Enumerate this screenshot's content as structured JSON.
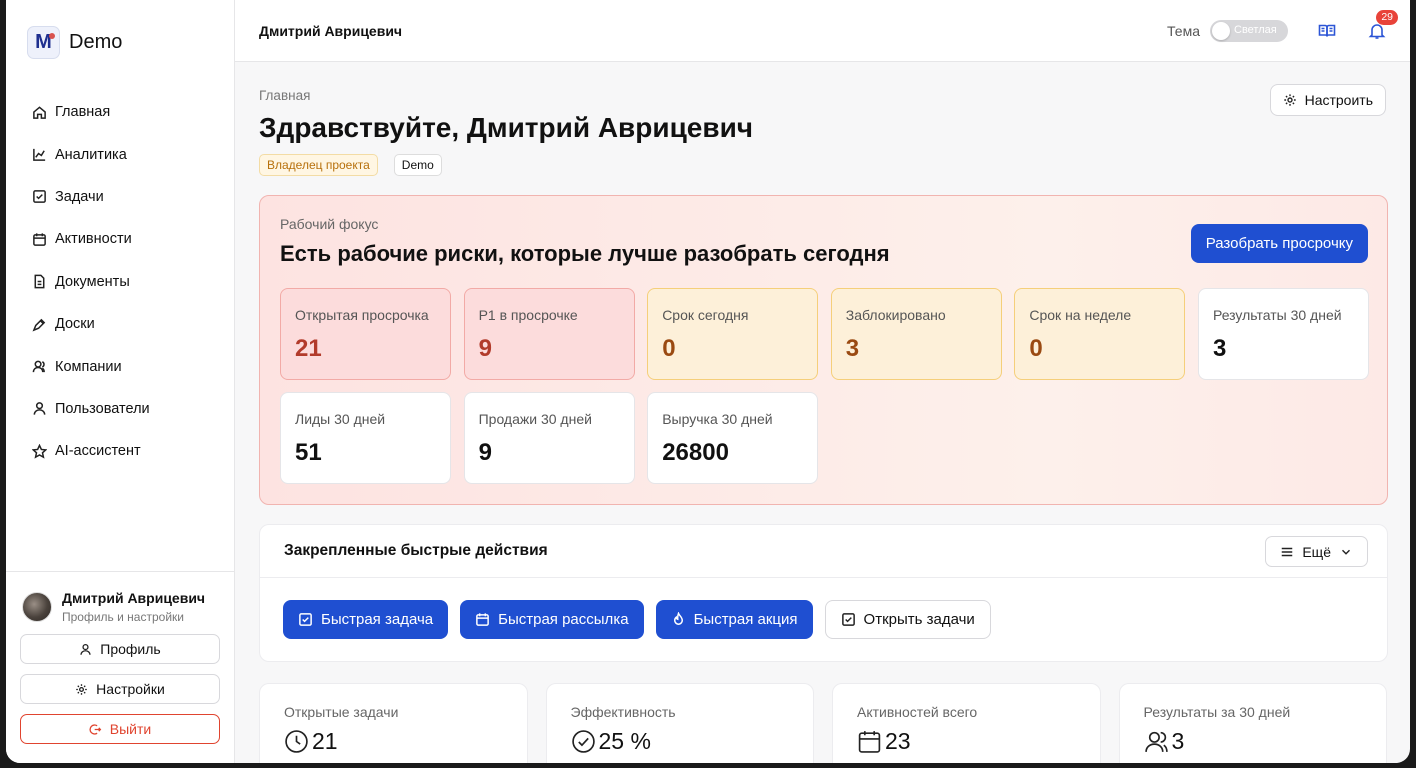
{
  "brand": {
    "name": "Demo",
    "logo_letter": "M"
  },
  "nav": [
    {
      "label": "Главная",
      "icon": "home-icon"
    },
    {
      "label": "Аналитика",
      "icon": "chart-icon"
    },
    {
      "label": "Задачи",
      "icon": "checkbox-icon"
    },
    {
      "label": "Активности",
      "icon": "calendar-icon"
    },
    {
      "label": "Документы",
      "icon": "document-icon"
    },
    {
      "label": "Доски",
      "icon": "pen-icon"
    },
    {
      "label": "Компании",
      "icon": "users-icon"
    },
    {
      "label": "Пользователи",
      "icon": "user-icon"
    },
    {
      "label": "AI-ассистент",
      "icon": "star-icon"
    }
  ],
  "sidebar_user": {
    "name": "Дмитрий Аврицевич",
    "subtitle": "Профиль и настройки",
    "profile_label": "Профиль",
    "settings_label": "Настройки",
    "logout_label": "Выйти"
  },
  "topbar": {
    "user_name": "Дмитрий Аврицевич",
    "theme_label": "Тема",
    "theme_value": "Светлая",
    "notifications_count": "29"
  },
  "header": {
    "breadcrumb": "Главная",
    "title": "Здравствуйте, Дмитрий Аврицевич",
    "tag_role": "Владелец проекта",
    "tag_project": "Demo",
    "setup_label": "Настроить"
  },
  "focus": {
    "label": "Рабочий фокус",
    "title": "Есть рабочие риски, которые лучше разобрать сегодня",
    "action_label": "Разобрать просрочку",
    "metrics": [
      {
        "label": "Открытая просрочка",
        "value": "21",
        "tone": "red"
      },
      {
        "label": "P1 в просрочке",
        "value": "9",
        "tone": "red"
      },
      {
        "label": "Срок сегодня",
        "value": "0",
        "tone": "yellow"
      },
      {
        "label": "Заблокировано",
        "value": "3",
        "tone": "yellow"
      },
      {
        "label": "Срок на неделе",
        "value": "0",
        "tone": "yellow"
      },
      {
        "label": "Результаты 30 дней",
        "value": "3",
        "tone": "plain"
      },
      {
        "label": "Лиды 30 дней",
        "value": "51",
        "tone": "plain"
      },
      {
        "label": "Продажи 30 дней",
        "value": "9",
        "tone": "plain"
      },
      {
        "label": "Выручка 30 дней",
        "value": "26800",
        "tone": "plain"
      }
    ]
  },
  "quick": {
    "title": "Закрепленные быстрые действия",
    "more_label": "Ещё",
    "actions": [
      {
        "label": "Быстрая задача",
        "icon": "checkbox-icon",
        "style": "primary"
      },
      {
        "label": "Быстрая рассылка",
        "icon": "calendar-icon",
        "style": "primary"
      },
      {
        "label": "Быстрая акция",
        "icon": "flame-icon",
        "style": "primary"
      },
      {
        "label": "Открыть задачи",
        "icon": "checkbox-icon",
        "style": "outline"
      }
    ]
  },
  "stats": [
    {
      "label": "Открытые задачи",
      "value": "21",
      "icon": "clock-icon"
    },
    {
      "label": "Эффективность",
      "value": "25 %",
      "icon": "check-circle-icon"
    },
    {
      "label": "Активностей всего",
      "value": "23",
      "icon": "calendar-icon"
    },
    {
      "label": "Результаты за 30 дней",
      "value": "3",
      "icon": "users-icon"
    }
  ],
  "colors": {
    "accent": "#1f4fd1",
    "danger": "#e0442f",
    "badge": "#e8433a"
  }
}
